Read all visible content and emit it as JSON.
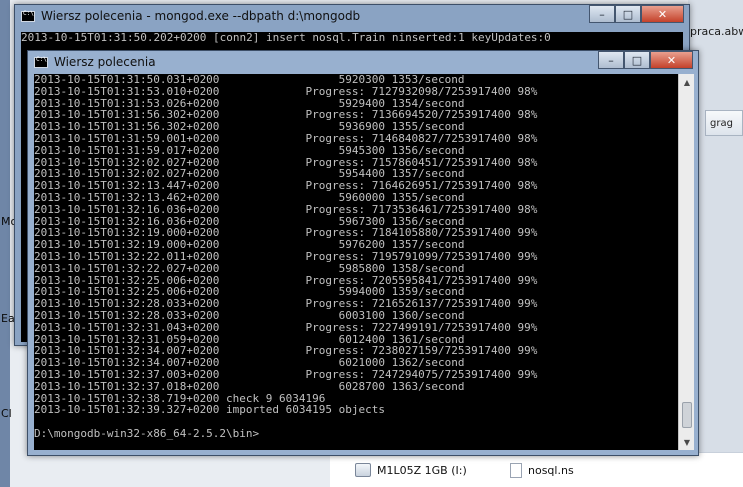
{
  "back_window": {
    "title": "Wiersz polecenia - mongod.exe  --dbpath d:\\mongodb",
    "console_line": "2013-10-15T01:31:50.202+0200 [conn2] insert nosql.Train ninserted:1 keyUpdates:0"
  },
  "front_window": {
    "title": "Wiersz polecenia",
    "lines": [
      "2013-10-15T01:31:50.031+0200                  5920300 1353/second",
      "2013-10-15T01:31:53.010+0200             Progress: 7127932098/7253917400 98%",
      "2013-10-15T01:31:53.026+0200                  5929400 1354/second",
      "2013-10-15T01:31:56.302+0200             Progress: 7136694520/7253917400 98%",
      "2013-10-15T01:31:56.302+0200                  5936900 1355/second",
      "2013-10-15T01:31:59.001+0200             Progress: 7146840827/7253917400 98%",
      "2013-10-15T01:31:59.017+0200                  5945300 1356/second",
      "2013-10-15T01:32:02.027+0200             Progress: 7157860451/7253917400 98%",
      "2013-10-15T01:32:02.027+0200                  5954400 1357/second",
      "2013-10-15T01:32:13.447+0200             Progress: 7164626951/7253917400 98%",
      "2013-10-15T01:32:13.462+0200                  5960000 1355/second",
      "2013-10-15T01:32:16.036+0200             Progress: 7173536461/7253917400 98%",
      "2013-10-15T01:32:16.036+0200                  5967300 1356/second",
      "2013-10-15T01:32:19.000+0200             Progress: 7184105880/7253917400 99%",
      "2013-10-15T01:32:19.000+0200                  5976200 1357/second",
      "2013-10-15T01:32:22.011+0200             Progress: 7195791099/7253917400 99%",
      "2013-10-15T01:32:22.027+0200                  5985800 1358/second",
      "2013-10-15T01:32:25.006+0200             Progress: 7205595841/7253917400 99%",
      "2013-10-15T01:32:25.006+0200                  5994000 1359/second",
      "2013-10-15T01:32:28.033+0200             Progress: 7216526137/7253917400 99%",
      "2013-10-15T01:32:28.033+0200                  6003100 1360/second",
      "2013-10-15T01:32:31.043+0200             Progress: 7227499191/7253917400 99%",
      "2013-10-15T01:32:31.059+0200                  6012400 1361/second",
      "2013-10-15T01:32:34.007+0200             Progress: 7238027159/7253917400 99%",
      "2013-10-15T01:32:34.007+0200                  6021000 1362/second",
      "2013-10-15T01:32:37.003+0200             Progress: 7247294075/7253917400 99%",
      "2013-10-15T01:32:37.018+0200                  6028700 1363/second",
      "2013-10-15T01:32:38.719+0200 check 9 6034196",
      "2013-10-15T01:32:39.327+0200 imported 6034195 objects",
      "",
      "D:\\mongodb-win32-x86_64-2.5.2\\bin>"
    ]
  },
  "desktop": {
    "icon_label": "praca.abw",
    "side_button": "grag",
    "left_letters": [
      "Mo",
      "Ea",
      "Cl"
    ],
    "drive_label": "M1L05Z 1GB (I:)",
    "file_label": "nosql.ns"
  },
  "controls": {
    "minimize": "–",
    "maximize": "□",
    "close": "✕"
  },
  "scroll_arrows": {
    "up": "▲",
    "down": "▼"
  }
}
